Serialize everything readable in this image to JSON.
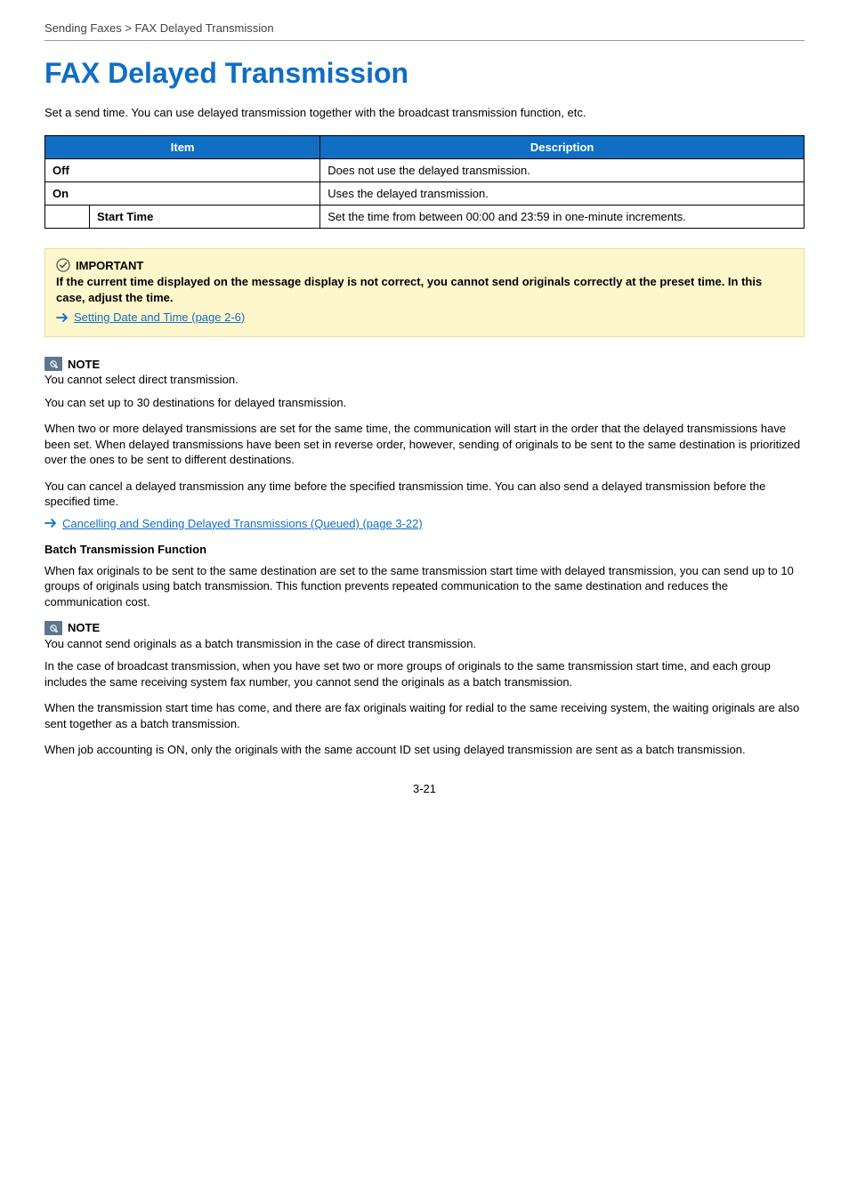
{
  "breadcrumb": "Sending Faxes > FAX Delayed Transmission",
  "title": "FAX Delayed Transmission",
  "intro": "Set a send time. You can use delayed transmission together with the broadcast transmission function, etc.",
  "table": {
    "headers": {
      "item": "Item",
      "description": "Description"
    },
    "rows": {
      "off": {
        "label": "Off",
        "desc": "Does not use the delayed transmission."
      },
      "on": {
        "label": "On",
        "desc": "Uses the delayed transmission."
      },
      "start_time": {
        "label": "Start Time",
        "desc": "Set the time from between 00:00 and 23:59 in one-minute increments."
      }
    }
  },
  "important": {
    "heading": "IMPORTANT",
    "body": "If the current time displayed on the message display is not correct, you cannot send originals correctly at the preset time. In this case, adjust the time.",
    "link": "Setting Date and Time (page 2-6)"
  },
  "note1": {
    "heading": "NOTE",
    "p1": "You cannot select direct transmission.",
    "p2": "You can set up to 30 destinations for delayed transmission.",
    "p3": "When two or more delayed transmissions are set for the same time, the communication will start in the order that the delayed transmissions have been set. When delayed transmissions have been set in reverse order, however, sending of originals to be sent to the same destination is prioritized over the ones to be sent to different destinations.",
    "p4": "You can cancel a delayed transmission any time before the specified transmission time. You can also send a delayed transmission before the specified time.",
    "link": "Cancelling and Sending Delayed Transmissions (Queued) (page 3-22)"
  },
  "batch": {
    "heading": "Batch Transmission Function",
    "p1": "When fax originals to be sent to the same destination are set to the same transmission start time with delayed transmission, you can send up to 10 groups of originals using batch transmission. This function prevents repeated communication to the same destination and reduces the communication cost."
  },
  "note2": {
    "heading": "NOTE",
    "p1": "You cannot send originals as a batch transmission in the case of direct transmission.",
    "p2": "In the case of broadcast transmission, when you have set two or more groups of originals to the same transmission start time, and each group includes the same receiving system fax number, you cannot send the originals as a batch transmission.",
    "p3": "When the transmission start time has come, and there are fax originals waiting for redial to the same receiving system, the waiting originals are also sent together as a batch transmission.",
    "p4": "When job accounting is ON, only the originals with the same account ID set using delayed transmission are sent as a batch transmission."
  },
  "page_number": "3-21"
}
